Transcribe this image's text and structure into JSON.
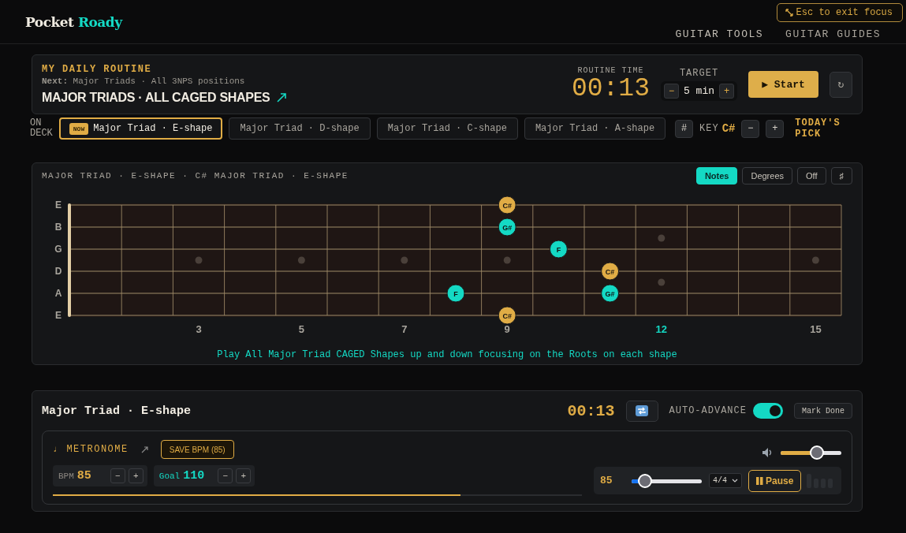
{
  "header": {
    "logo": {
      "first": "Pocket",
      "second": "Roady"
    },
    "nav": [
      {
        "label": "GUITAR TOOLS"
      },
      {
        "label": "GUITAR GUIDES"
      }
    ],
    "focus_badge": "Esc to exit focus"
  },
  "routine": {
    "heading": "MY DAILY ROUTINE",
    "next": "**Next:** Major Triads · All 3NPS positions",
    "title": "MAJOR TRIADS · ALL CAGED SHAPES",
    "time_label": "ROUTINE TIME",
    "time": "00:13",
    "target_label": "TARGET",
    "target": "5 min",
    "decrement": "−",
    "increment": "+",
    "start": "▶ Start",
    "reset": "↻"
  },
  "on_deck": {
    "label": "ON DECK",
    "items": [
      {
        "label": "Major Triad · E-shape",
        "selected": true,
        "badge": "NOW"
      },
      {
        "label": "Major Triad · D-shape",
        "selected": false
      },
      {
        "label": "Major Triad · C-shape",
        "selected": false
      },
      {
        "label": "Major Triad · A-shape",
        "selected": false
      }
    ],
    "key": {
      "sharp": "#",
      "label": "KEY",
      "value": "C#",
      "decrement": "−",
      "increment": "+"
    },
    "pick": "TODAY'S PICK"
  },
  "fretboard": {
    "title": "MAJOR TRIAD · E-SHAPE · C# MAJOR TRIAD · E-SHAPE",
    "modes": [
      {
        "label": "Notes",
        "selected": true
      },
      {
        "label": "Degrees",
        "selected": false
      },
      {
        "label": "Off",
        "selected": false
      }
    ],
    "accidental": "♯",
    "strings": [
      {
        "name": "E",
        "frets": [
          {
            "kind": "empty"
          },
          {
            "kind": "empty"
          },
          {
            "kind": "empty"
          },
          {
            "kind": "empty"
          },
          {
            "kind": "empty"
          },
          {
            "kind": "empty"
          },
          {
            "kind": "empty"
          },
          {
            "kind": "empty"
          },
          {
            "kind": "note",
            "label": "C#",
            "color": "#e0ac45"
          },
          {
            "kind": "empty"
          },
          {
            "kind": "empty"
          },
          {
            "kind": "empty"
          },
          {
            "kind": "empty"
          },
          {
            "kind": "empty"
          },
          {
            "kind": "empty"
          }
        ]
      },
      {
        "name": "B",
        "frets": [
          {
            "kind": "empty"
          },
          {
            "kind": "empty"
          },
          {
            "kind": "empty"
          },
          {
            "kind": "empty"
          },
          {
            "kind": "empty"
          },
          {
            "kind": "empty"
          },
          {
            "kind": "empty"
          },
          {
            "kind": "empty"
          },
          {
            "kind": "note",
            "label": "G#",
            "color": "#14d9c4"
          },
          {
            "kind": "empty"
          },
          {
            "kind": "empty"
          },
          {
            "kind": "empty"
          },
          {
            "kind": "empty"
          },
          {
            "kind": "empty"
          },
          {
            "kind": "empty"
          }
        ]
      },
      {
        "name": "G",
        "frets": [
          {
            "kind": "empty"
          },
          {
            "kind": "empty"
          },
          {
            "kind": "empty"
          },
          {
            "kind": "empty"
          },
          {
            "kind": "empty"
          },
          {
            "kind": "empty"
          },
          {
            "kind": "empty"
          },
          {
            "kind": "empty"
          },
          {
            "kind": "empty"
          },
          {
            "kind": "note",
            "label": "F",
            "color": "#14d9c4"
          },
          {
            "kind": "empty"
          },
          {
            "kind": "empty"
          },
          {
            "kind": "empty"
          },
          {
            "kind": "empty"
          },
          {
            "kind": "empty"
          }
        ]
      },
      {
        "name": "D",
        "frets": [
          {
            "kind": "empty"
          },
          {
            "kind": "empty"
          },
          {
            "kind": "empty"
          },
          {
            "kind": "empty"
          },
          {
            "kind": "empty"
          },
          {
            "kind": "empty"
          },
          {
            "kind": "empty"
          },
          {
            "kind": "empty"
          },
          {
            "kind": "empty"
          },
          {
            "kind": "empty"
          },
          {
            "kind": "note",
            "label": "C#",
            "color": "#e0ac45"
          },
          {
            "kind": "empty"
          },
          {
            "kind": "empty"
          },
          {
            "kind": "empty"
          },
          {
            "kind": "empty"
          }
        ]
      },
      {
        "name": "A",
        "frets": [
          {
            "kind": "empty"
          },
          {
            "kind": "empty"
          },
          {
            "kind": "empty"
          },
          {
            "kind": "empty"
          },
          {
            "kind": "empty"
          },
          {
            "kind": "empty"
          },
          {
            "kind": "empty"
          },
          {
            "kind": "note",
            "label": "F",
            "color": "#14d9c4"
          },
          {
            "kind": "empty"
          },
          {
            "kind": "empty"
          },
          {
            "kind": "note",
            "label": "G#",
            "color": "#14d9c4"
          },
          {
            "kind": "empty"
          },
          {
            "kind": "empty"
          },
          {
            "kind": "empty"
          },
          {
            "kind": "empty"
          }
        ]
      },
      {
        "name": "E",
        "frets": [
          {
            "kind": "empty"
          },
          {
            "kind": "empty"
          },
          {
            "kind": "empty"
          },
          {
            "kind": "empty"
          },
          {
            "kind": "empty"
          },
          {
            "kind": "empty"
          },
          {
            "kind": "empty"
          },
          {
            "kind": "empty"
          },
          {
            "kind": "note",
            "label": "C#",
            "color": "#e0ac45"
          },
          {
            "kind": "empty"
          },
          {
            "kind": "empty"
          },
          {
            "kind": "empty"
          },
          {
            "kind": "empty"
          },
          {
            "kind": "empty"
          },
          {
            "kind": "empty"
          }
        ]
      }
    ],
    "fret_numbers": [
      {
        "label": "3",
        "highlighted": false
      },
      {
        "label": "5",
        "highlighted": false
      },
      {
        "label": "7",
        "highlighted": false
      },
      {
        "label": "9",
        "highlighted": false
      },
      {
        "label": "12",
        "highlighted": true
      },
      {
        "label": "15",
        "highlighted": false
      }
    ],
    "instruction": "Play All Major Triad CAGED Shapes up and down focusing on the Roots on each shape"
  },
  "session": {
    "title": "Major Triad · E-shape",
    "time": "00:13",
    "auto_advance": {
      "label": "AUTO-ADVANCE",
      "on": true
    },
    "mark_done": "Mark Done",
    "metronome": {
      "label": "♩ METRONOME",
      "save": "SAVE BPM (85)",
      "bpm": {
        "label": "BPM",
        "value": "85",
        "decrement": "−",
        "increment": "+"
      },
      "goal": {
        "label": "Goal",
        "value": "110",
        "decrement": "−",
        "increment": "+"
      },
      "progress": {
        "level": 0.77
      },
      "volume": {
        "level": 0.6
      },
      "tempo": {
        "value": "85",
        "level": 0.19
      },
      "time_signature": "4/4",
      "pause": "Pause"
    }
  }
}
